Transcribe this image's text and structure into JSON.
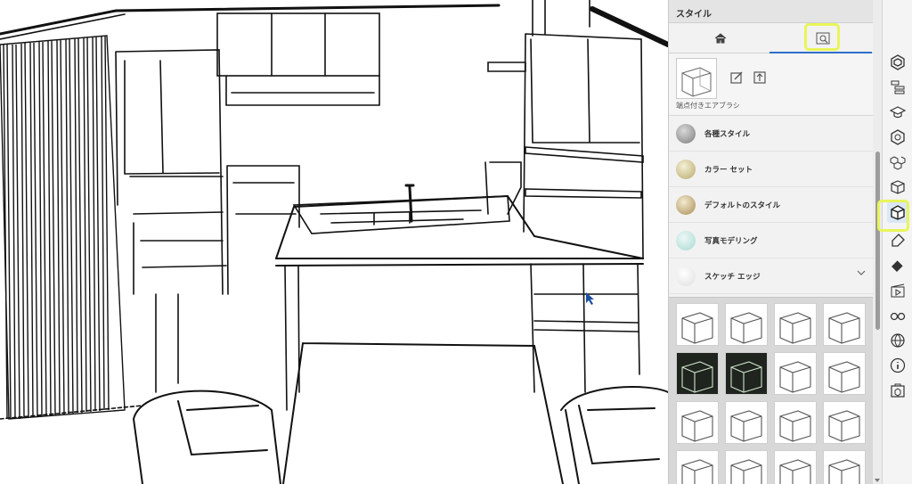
{
  "panel": {
    "title": "スタイル",
    "current_style_name": "端点付きエアブラシ",
    "collections": [
      {
        "label": "各種スタイル",
        "icon": "style-sphere-icon"
      },
      {
        "label": "カラー セット",
        "icon": "color-set-icon"
      },
      {
        "label": "デフォルトのスタイル",
        "icon": "default-style-icon"
      },
      {
        "label": "写真モデリング",
        "icon": "photo-modeling-icon"
      },
      {
        "label": "スケッチ エッジ",
        "icon": "sketch-edge-icon"
      }
    ]
  },
  "tray": {
    "tools": [
      "3d-warehouse-icon",
      "outliner-icon",
      "instructor-icon",
      "components-icon",
      "materials-icon",
      "entity-info-icon",
      "styles-icon",
      "tags-icon",
      "soften-edges-icon",
      "scenes-icon",
      "display-icon",
      "shadows-icon",
      "info-icon",
      "extension-icon"
    ]
  },
  "colors": {
    "highlight": "#e8f55a",
    "accent": "#2d6fc9"
  }
}
